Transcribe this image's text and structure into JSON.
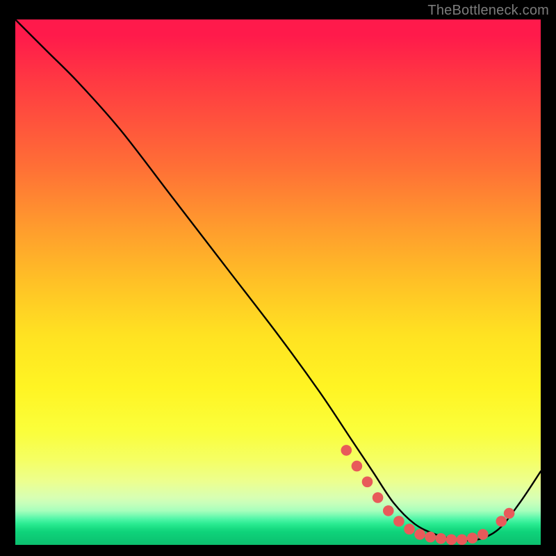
{
  "attribution": "TheBottleneck.com",
  "colors": {
    "marker": "#e85a5a",
    "line": "#000000"
  },
  "chart_data": {
    "type": "line",
    "title": "",
    "xlabel": "",
    "ylabel": "",
    "xlim": [
      0,
      100
    ],
    "ylim": [
      0,
      100
    ],
    "grid": false,
    "legend": false,
    "series": [
      {
        "name": "curve",
        "x": [
          0,
          6,
          12,
          20,
          30,
          40,
          50,
          58,
          64,
          68,
          72,
          76,
          80,
          84,
          88,
          92,
          96,
          100
        ],
        "y": [
          100,
          94,
          88,
          79,
          66,
          53,
          40,
          29,
          20,
          14,
          8,
          4,
          2,
          1,
          1,
          3,
          8,
          14
        ]
      }
    ],
    "markers": [
      {
        "x": 63,
        "y": 18
      },
      {
        "x": 65,
        "y": 15
      },
      {
        "x": 67,
        "y": 12
      },
      {
        "x": 69,
        "y": 9
      },
      {
        "x": 71,
        "y": 6.5
      },
      {
        "x": 73,
        "y": 4.5
      },
      {
        "x": 75,
        "y": 3
      },
      {
        "x": 77,
        "y": 2
      },
      {
        "x": 79,
        "y": 1.5
      },
      {
        "x": 81,
        "y": 1.2
      },
      {
        "x": 83,
        "y": 1
      },
      {
        "x": 85,
        "y": 1
      },
      {
        "x": 87,
        "y": 1.3
      },
      {
        "x": 89,
        "y": 2
      },
      {
        "x": 92.5,
        "y": 4.5
      },
      {
        "x": 94,
        "y": 6
      }
    ]
  }
}
